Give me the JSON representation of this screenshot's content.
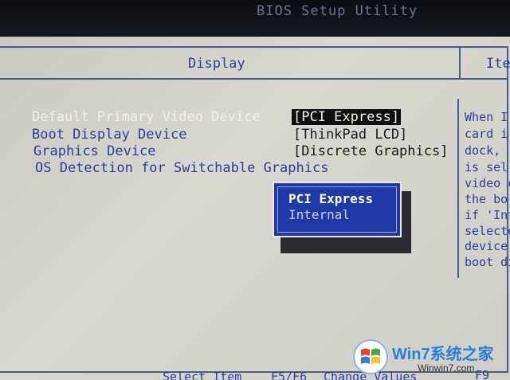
{
  "window": {
    "title": "BIOS Setup Utility"
  },
  "tabs": [
    {
      "label": "Display"
    },
    {
      "label": "Ite"
    }
  ],
  "settings": [
    {
      "label": "Default Primary Video Device",
      "value": "[PCI Express]"
    },
    {
      "label": "Boot Display Device",
      "value": "[ThinkPad LCD]"
    },
    {
      "label": "Graphics Device",
      "value": "[Discrete Graphics]"
    },
    {
      "label": "OS Detection for Switchable Graphics",
      "value": ""
    }
  ],
  "popup": {
    "options": [
      "PCI Express",
      "Internal"
    ]
  },
  "help": [
    "When I",
    "card i",
    "dock, ",
    "is sel",
    "video c",
    "the bo",
    "if 'Int",
    "selecte",
    "device",
    "boot di"
  ],
  "bottombar": {
    "item1": "Select Item",
    "item2_key": "F5/F6",
    "item2_desc": "Change Values",
    "item3_key": "F9"
  },
  "watermark": {
    "logo_text": "Win7系统之家",
    "url_text": "Winwin7.com"
  },
  "colors": {
    "accent": "#2b3f9a",
    "popup_bg": "#1f3aa8",
    "screen_bg": "#d3d3cb"
  }
}
